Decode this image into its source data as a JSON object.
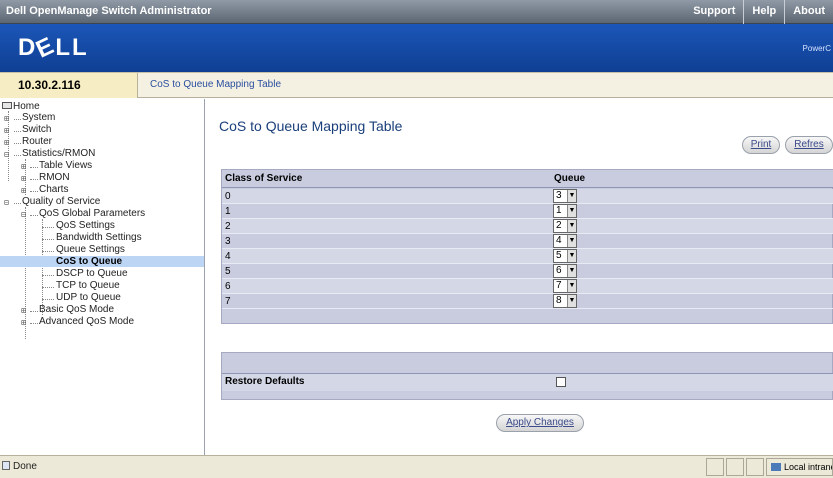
{
  "app": {
    "title": "Dell OpenManage Switch Administrator"
  },
  "toplinks": [
    "Support",
    "Help",
    "About"
  ],
  "brand": {
    "logo": "D&LL",
    "right_text": "PowerC"
  },
  "address": {
    "ip": "10.30.2.116",
    "breadcrumb": "CoS to Queue Mapping Table"
  },
  "nav": {
    "home": "Home",
    "system": "System",
    "switch": "Switch",
    "router": "Router",
    "statistics": "Statistics/RMON",
    "table_views": "Table Views",
    "rmon": "RMON",
    "charts": "Charts",
    "qos": "Quality of Service",
    "qos_global": "QoS Global Parameters",
    "qos_settings": "QoS Settings",
    "bandwidth": "Bandwidth Settings",
    "queue_settings": "Queue Settings",
    "cos_queue": "CoS to Queue",
    "dscp_queue": "DSCP to Queue",
    "tcp_queue": "TCP to Queue",
    "udp_queue": "UDP to Queue",
    "basic_qos": "Basic QoS Mode",
    "advanced_qos": "Advanced QoS Mode"
  },
  "main": {
    "title": "CoS to Queue Mapping Table",
    "print": "Print",
    "refresh": "Refres",
    "col_cos": "Class of Service",
    "col_queue": "Queue",
    "rows": [
      {
        "cos": "0",
        "queue": "3"
      },
      {
        "cos": "1",
        "queue": "1"
      },
      {
        "cos": "2",
        "queue": "2"
      },
      {
        "cos": "3",
        "queue": "4"
      },
      {
        "cos": "4",
        "queue": "5"
      },
      {
        "cos": "5",
        "queue": "6"
      },
      {
        "cos": "6",
        "queue": "7"
      },
      {
        "cos": "7",
        "queue": "8"
      }
    ],
    "restore_defaults": "Restore Defaults",
    "apply": "Apply Changes"
  },
  "status": {
    "left": "Done",
    "zone": "Local intrane"
  },
  "colors": {
    "brand": "#1b56b8",
    "header_bg": "#c8ccde",
    "selected_nav": "#bcd5f5"
  }
}
